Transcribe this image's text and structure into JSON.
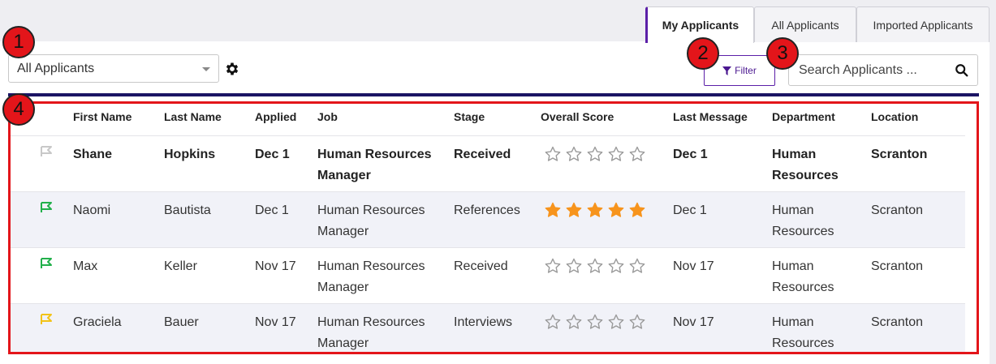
{
  "tabs": [
    {
      "label": "My Applicants",
      "active": true
    },
    {
      "label": "All Applicants",
      "active": false
    },
    {
      "label": "Imported Applicants",
      "active": false
    }
  ],
  "view_select": {
    "value": "All Applicants"
  },
  "filter": {
    "label": "Filter"
  },
  "search": {
    "placeholder": "Search Applicants ..."
  },
  "columns": [
    "First Name",
    "Last Name",
    "Applied",
    "Job",
    "Stage",
    "Overall Score",
    "Last Message",
    "Department",
    "Location"
  ],
  "rows": [
    {
      "first": "Shane",
      "last": "Hopkins",
      "applied": "Dec 1",
      "job_line1": "Human Resources",
      "job_line2": "Manager",
      "stage": "Received",
      "score": 0,
      "last_message": "Dec 1",
      "dept_line1": "Human",
      "dept_line2": "Resources",
      "location": "Scranton",
      "flag_color": "#c8c8c8",
      "unread": true
    },
    {
      "first": "Naomi",
      "last": "Bautista",
      "applied": "Dec 1",
      "job_line1": "Human Resources",
      "job_line2": "Manager",
      "stage": "References",
      "score": 5,
      "last_message": "Dec 1",
      "dept_line1": "Human",
      "dept_line2": "Resources",
      "location": "Scranton",
      "flag_color": "#22b04b",
      "unread": false
    },
    {
      "first": "Max",
      "last": "Keller",
      "applied": "Nov 17",
      "job_line1": "Human Resources",
      "job_line2": "Manager",
      "stage": "Received",
      "score": 0,
      "last_message": "Nov 17",
      "dept_line1": "Human",
      "dept_line2": "Resources",
      "location": "Scranton",
      "flag_color": "#22b04b",
      "unread": false
    },
    {
      "first": "Graciela",
      "last": "Bauer",
      "applied": "Nov 17",
      "job_line1": "Human Resources",
      "job_line2": "Manager",
      "stage": "Interviews",
      "score": 0,
      "last_message": "Nov 17",
      "dept_line1": "Human",
      "dept_line2": "Resources",
      "location": "Scranton",
      "flag_color": "#f2c318",
      "unread": false
    }
  ],
  "callouts": [
    "1",
    "2",
    "3",
    "4"
  ],
  "colors": {
    "accent": "#5b1fa8",
    "star_filled": "#f7941d",
    "star_empty": "#9a9a9a",
    "highlight": "#e3151a",
    "navy": "#1b1464"
  }
}
